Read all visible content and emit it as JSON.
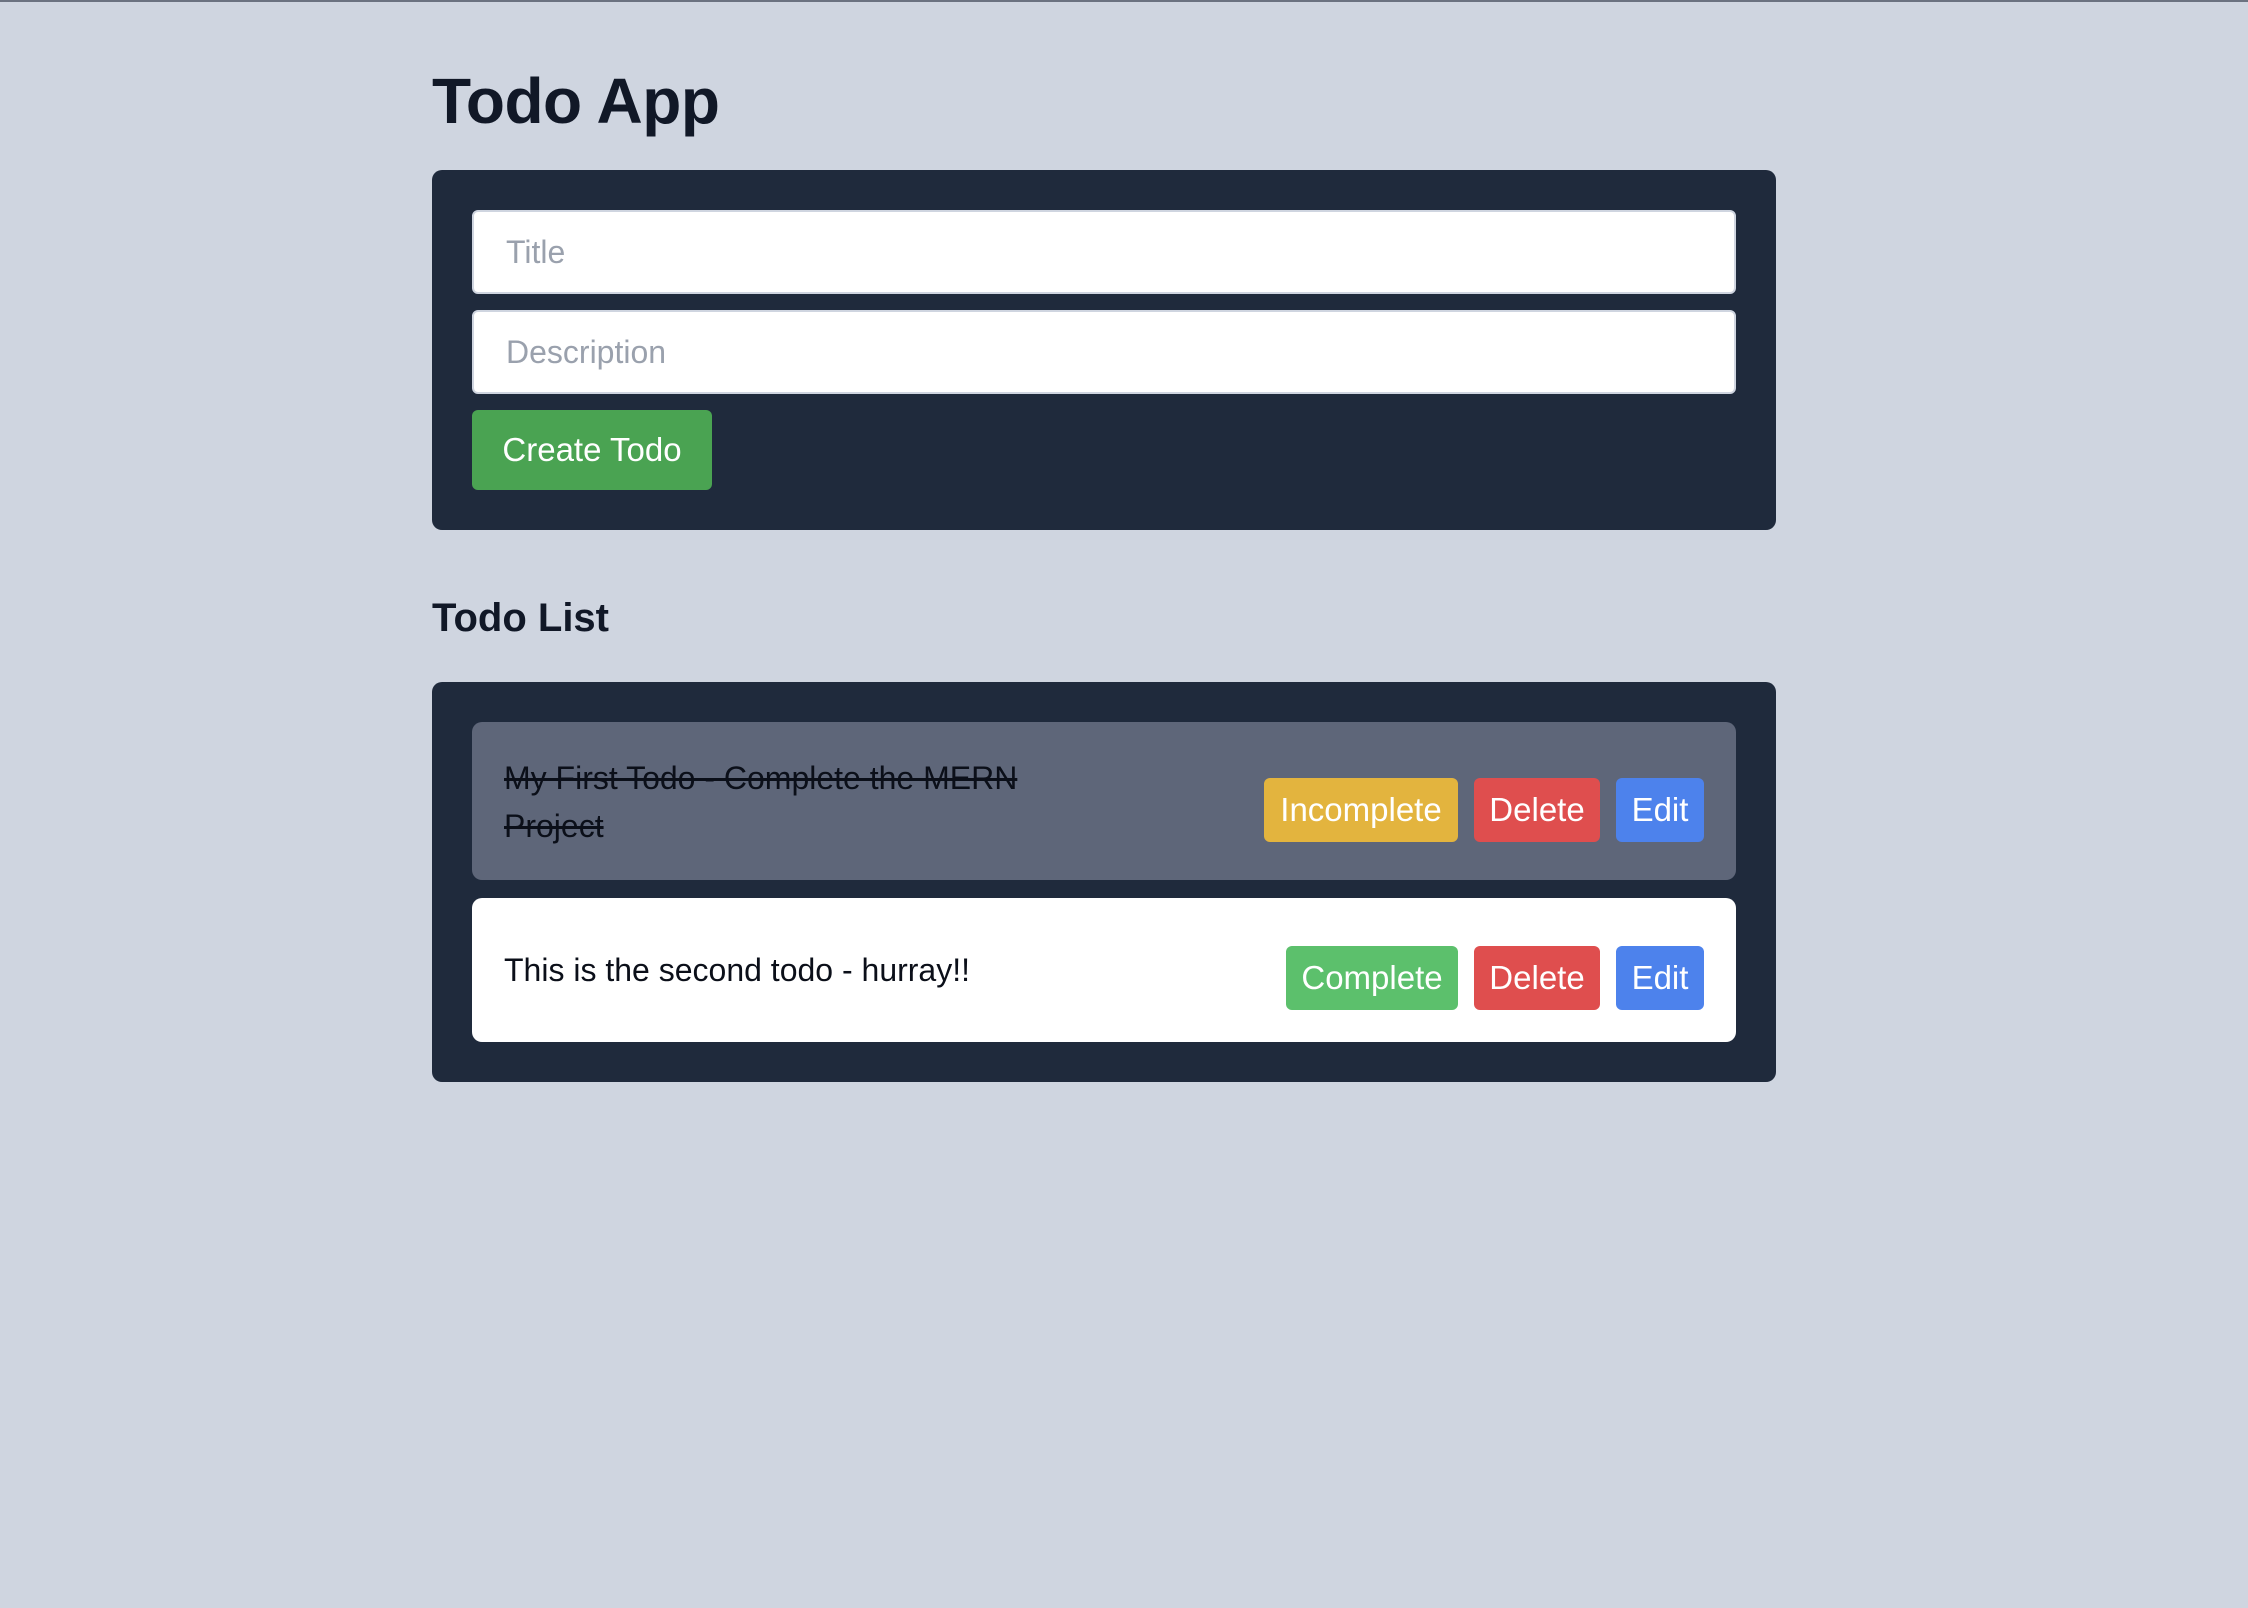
{
  "app": {
    "title": "Todo App"
  },
  "form": {
    "title_placeholder": "Title",
    "title_value": "",
    "description_placeholder": "Description",
    "description_value": "",
    "create_label": "Create Todo"
  },
  "list": {
    "heading": "Todo List",
    "items": [
      {
        "text": "My First Todo - Complete the MERN Project",
        "completed": true,
        "toggle_label": "Incomplete",
        "delete_label": "Delete",
        "edit_label": "Edit"
      },
      {
        "text": "This is the second todo - hurray!!",
        "completed": false,
        "toggle_label": "Complete",
        "delete_label": "Delete",
        "edit_label": "Edit"
      }
    ]
  },
  "colors": {
    "page_background": "#cfd5e0",
    "card_background": "#1f2a3c",
    "create_button": "#4aa352",
    "completed_item_background": "#5e6679",
    "incomplete_button": "#e3b43e",
    "complete_button": "#5cc06c",
    "delete_button": "#df4e4e",
    "edit_button": "#4d82ec"
  }
}
